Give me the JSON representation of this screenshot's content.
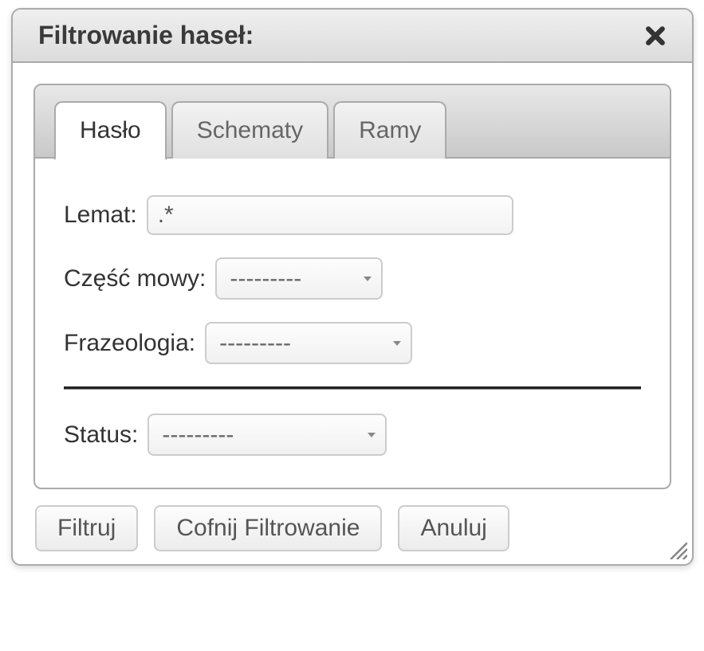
{
  "dialog": {
    "title": "Filtrowanie haseł:"
  },
  "tabs": [
    {
      "label": "Hasło",
      "active": true
    },
    {
      "label": "Schematy",
      "active": false
    },
    {
      "label": "Ramy",
      "active": false
    }
  ],
  "fields": {
    "lemat": {
      "label": "Lemat:",
      "value": ".*"
    },
    "czesc_mowy": {
      "label": "Część mowy:",
      "value": "---------"
    },
    "frazeologia": {
      "label": "Frazeologia:",
      "value": "---------"
    },
    "status": {
      "label": "Status:",
      "value": "---------"
    }
  },
  "buttons": {
    "filter": "Filtruj",
    "undo": "Cofnij Filtrowanie",
    "cancel": "Anuluj"
  },
  "icons": {
    "close": "close-icon",
    "resize": "resize-grip-icon"
  }
}
